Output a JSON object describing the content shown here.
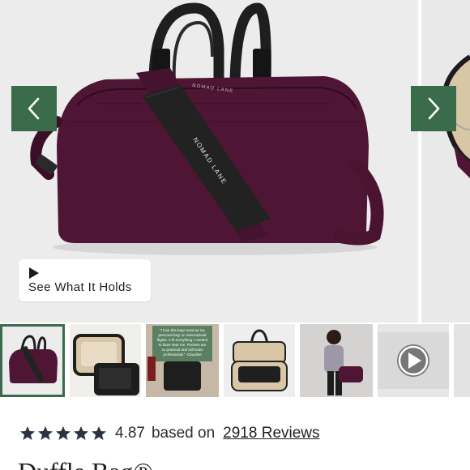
{
  "gallery": {
    "main_brand_text": "NOMAD LANE",
    "strap_brand_text": "NOMAD LANE",
    "prev_label": "Previous image",
    "next_label": "Next image",
    "see_what_label": "See What It Holds",
    "bag_color": "#4e1634",
    "accent_color": "#3a6b4a"
  },
  "thumbnails": [
    {
      "name": "thumb-bag-front",
      "active": true
    },
    {
      "name": "thumb-bag-open-top",
      "active": false
    },
    {
      "name": "thumb-bag-quote",
      "active": false,
      "quote": "\"I love this bag! Used as my personal bag on international flights. It fit everything I needed to have near me. Pockets are so practical and still looks professional.\" -Claudine"
    },
    {
      "name": "thumb-bag-open-inside",
      "active": false
    },
    {
      "name": "thumb-model-with-bag",
      "active": false
    },
    {
      "name": "thumb-video",
      "active": false
    },
    {
      "name": "thumb-partial",
      "active": false
    }
  ],
  "rating": {
    "stars": 5,
    "value": "4.87",
    "based_on": "based on",
    "reviews": "2918 Reviews"
  },
  "product": {
    "title": "Duffle Bag®"
  }
}
